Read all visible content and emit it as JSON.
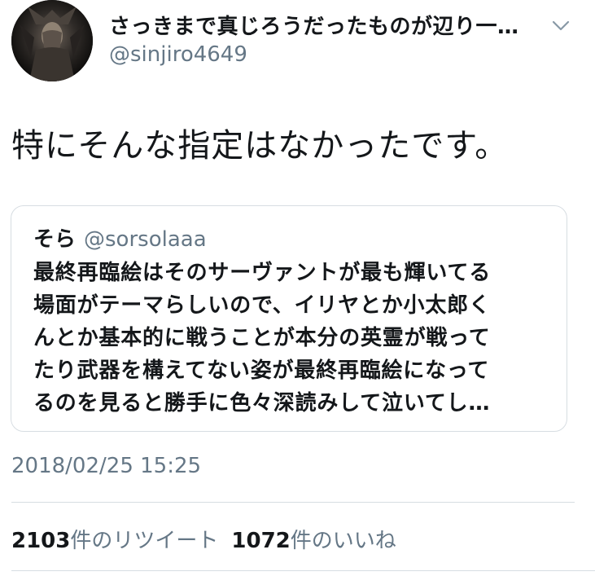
{
  "author": {
    "name": "さっきまで真じろうだったものが辺り一…",
    "handle": "@sinjiro4649"
  },
  "tweet": {
    "text": "特にそんな指定はなかったです。"
  },
  "quote": {
    "name": "そら",
    "handle": "@sorsolaaa",
    "lines": [
      "最終再臨絵はそのサーヴァントが最も輝いてる",
      "場面がテーマらしいので、イリヤとか小太郎く",
      "んとか基本的に戦うことが本分の英霊が戦って",
      "たり武器を構えてない姿が最終再臨絵になって",
      "るのを見ると勝手に色々深読みして泣いてし…"
    ]
  },
  "timestamp": "2018/02/25 15:25",
  "stats": {
    "retweets_count": "2103",
    "retweets_label": "件のリツイート",
    "likes_count": "1072",
    "likes_label": "件のいいね"
  },
  "colors": {
    "text_primary": "#14171a",
    "text_secondary": "#657786",
    "border": "#d7dde2",
    "background": "#ffffff"
  },
  "icons": {
    "avatar": "avatar-image",
    "menu": "chevron-down-icon"
  }
}
